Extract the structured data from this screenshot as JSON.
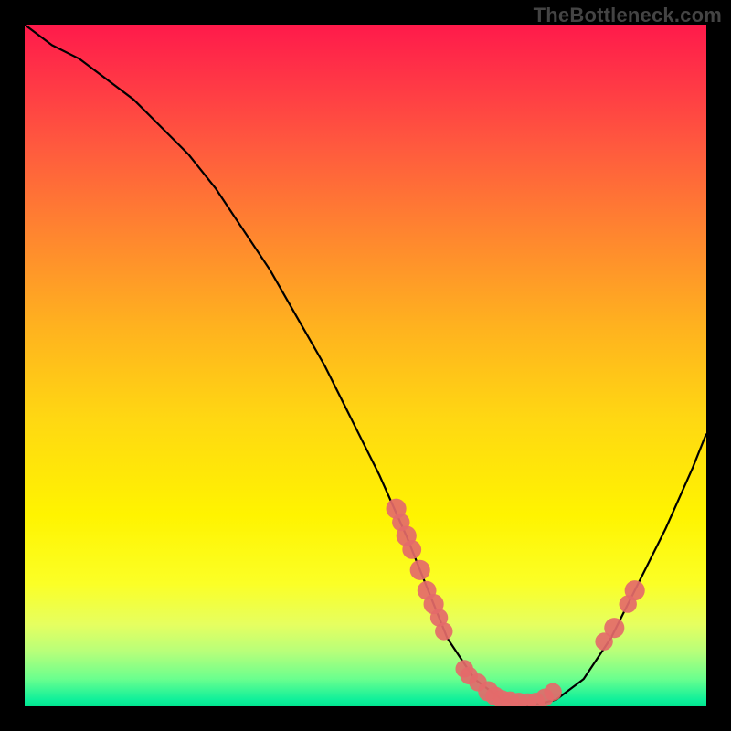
{
  "watermark": "TheBottleneck.com",
  "chart_data": {
    "type": "line",
    "title": "",
    "xlabel": "",
    "ylabel": "",
    "xlim": [
      0,
      100
    ],
    "ylim": [
      0,
      100
    ],
    "grid": false,
    "series": [
      {
        "name": "bottleneck-curve",
        "x": [
          0,
          4,
          8,
          12,
          16,
          20,
          24,
          28,
          32,
          36,
          40,
          44,
          48,
          52,
          56,
          58,
          62,
          66,
          70,
          74,
          78,
          82,
          86,
          90,
          94,
          98,
          100
        ],
        "values": [
          100,
          97,
          95,
          92,
          89,
          85,
          81,
          76,
          70,
          64,
          57,
          50,
          42,
          34,
          25,
          20,
          10,
          4,
          1,
          0,
          1,
          4,
          10,
          18,
          26,
          35,
          40
        ],
        "color": "#000000"
      }
    ],
    "markers": [
      {
        "name": "left-cluster-dot",
        "x": 54.5,
        "y": 29,
        "r": 1.2
      },
      {
        "name": "left-cluster-dot",
        "x": 55.2,
        "y": 27,
        "r": 1.0
      },
      {
        "name": "left-cluster-dot",
        "x": 56.0,
        "y": 25,
        "r": 1.2
      },
      {
        "name": "left-cluster-dot",
        "x": 56.8,
        "y": 23,
        "r": 1.1
      },
      {
        "name": "left-cluster-dot",
        "x": 58.0,
        "y": 20,
        "r": 1.2
      },
      {
        "name": "left-cluster-dot",
        "x": 59.0,
        "y": 17,
        "r": 1.1
      },
      {
        "name": "left-cluster-dot",
        "x": 60.0,
        "y": 15,
        "r": 1.2
      },
      {
        "name": "left-cluster-dot",
        "x": 60.8,
        "y": 13,
        "r": 1.0
      },
      {
        "name": "left-cluster-dot",
        "x": 61.5,
        "y": 11,
        "r": 1.0
      },
      {
        "name": "valley-dot",
        "x": 64.5,
        "y": 5.5,
        "r": 1.0
      },
      {
        "name": "valley-dot",
        "x": 65.2,
        "y": 4.5,
        "r": 1.0
      },
      {
        "name": "valley-dot",
        "x": 66.5,
        "y": 3.5,
        "r": 1.0
      },
      {
        "name": "valley-dot",
        "x": 68.0,
        "y": 2.2,
        "r": 1.2
      },
      {
        "name": "valley-dot",
        "x": 69.0,
        "y": 1.5,
        "r": 1.1
      },
      {
        "name": "valley-dot",
        "x": 70.0,
        "y": 1.0,
        "r": 1.1
      },
      {
        "name": "valley-dot",
        "x": 71.2,
        "y": 0.8,
        "r": 1.1
      },
      {
        "name": "valley-dot",
        "x": 72.5,
        "y": 0.7,
        "r": 1.0
      },
      {
        "name": "valley-dot",
        "x": 73.8,
        "y": 0.6,
        "r": 1.0
      },
      {
        "name": "valley-dot",
        "x": 75.0,
        "y": 0.7,
        "r": 1.0
      },
      {
        "name": "valley-dot",
        "x": 76.3,
        "y": 1.3,
        "r": 1.0
      },
      {
        "name": "valley-dot",
        "x": 77.5,
        "y": 2.1,
        "r": 1.0
      },
      {
        "name": "right-cluster-dot",
        "x": 85.0,
        "y": 9.5,
        "r": 1.0
      },
      {
        "name": "right-cluster-dot",
        "x": 86.5,
        "y": 11.5,
        "r": 1.2
      },
      {
        "name": "right-cluster-dot",
        "x": 88.5,
        "y": 15.0,
        "r": 1.0
      },
      {
        "name": "right-cluster-dot",
        "x": 89.5,
        "y": 17.0,
        "r": 1.2
      }
    ],
    "marker_color": "#e46a6a"
  }
}
